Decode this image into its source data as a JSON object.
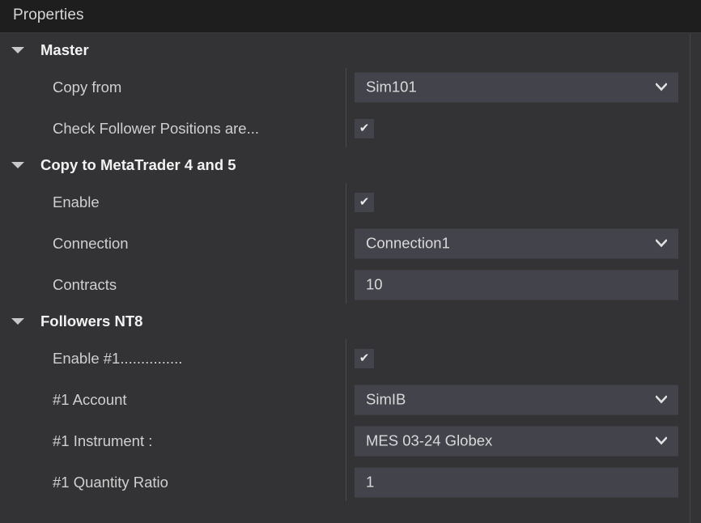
{
  "window": {
    "title": "Properties"
  },
  "theme": {
    "panel_background": "#333335",
    "titlebar_background": "#1e1e1e",
    "field_background": "#43434b",
    "label_color": "#cfcfcf",
    "header_color": "#f2f2f2",
    "divider_color": "#4a4a4e"
  },
  "icons": {
    "expanded_twisty": "triangle-down-icon",
    "dropdown_chevron": "chevron-down-icon",
    "checkbox_tick": "check-icon"
  },
  "groups": [
    {
      "title": "Master",
      "expanded": true,
      "rows": [
        {
          "label": "Copy from",
          "type": "combobox",
          "value": "Sim101"
        },
        {
          "label": "Check Follower Positions are...",
          "type": "checkbox",
          "checked": true,
          "value": "✔"
        }
      ]
    },
    {
      "title": "Copy to MetaTrader 4 and 5",
      "expanded": true,
      "rows": [
        {
          "label": "Enable",
          "type": "checkbox",
          "checked": true,
          "value": "✔"
        },
        {
          "label": "Connection",
          "type": "combobox",
          "value": "Connection1"
        },
        {
          "label": "Contracts",
          "type": "text",
          "value": "10"
        }
      ]
    },
    {
      "title": "Followers NT8",
      "expanded": true,
      "rows": [
        {
          "label": "Enable #1...............",
          "type": "checkbox",
          "checked": true,
          "value": "✔"
        },
        {
          "label": "#1 Account",
          "type": "combobox",
          "value": "SimIB"
        },
        {
          "label": "#1 Instrument :",
          "type": "combobox",
          "value": "MES 03-24 Globex"
        },
        {
          "label": "#1 Quantity Ratio",
          "type": "text",
          "value": "1"
        }
      ]
    }
  ]
}
